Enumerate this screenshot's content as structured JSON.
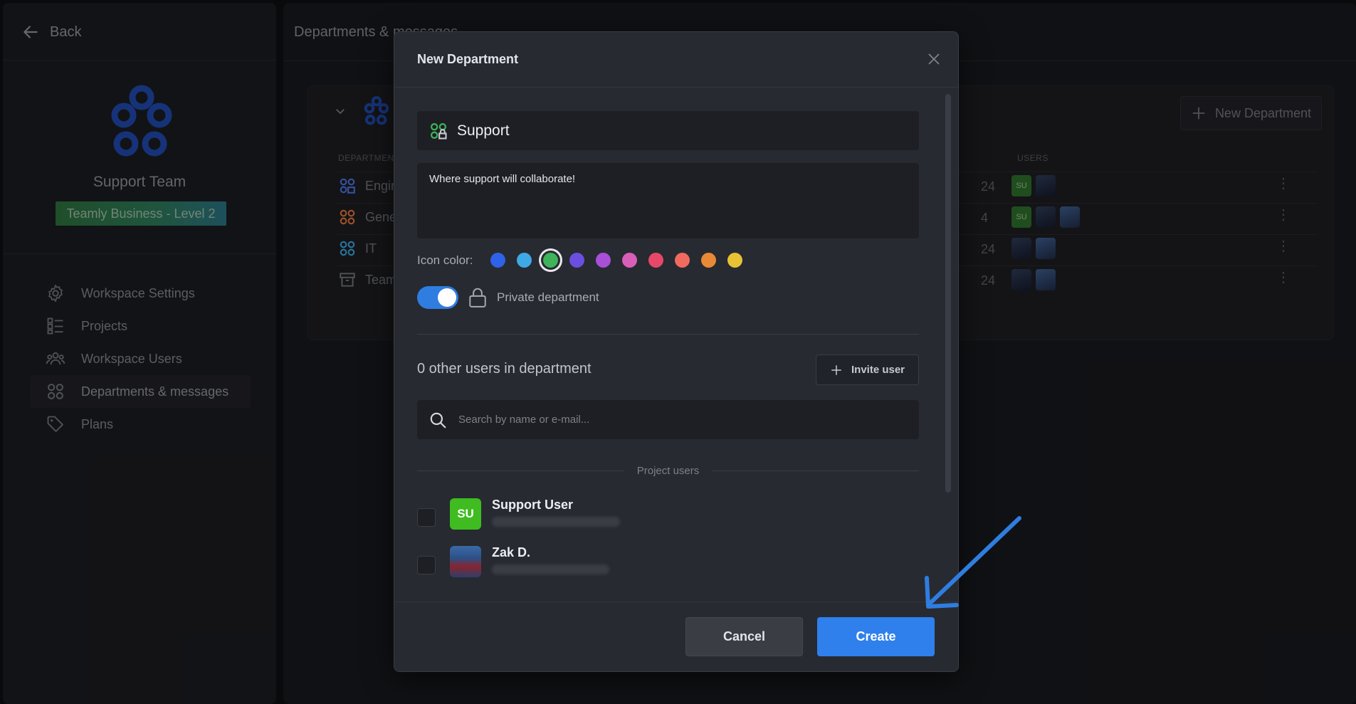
{
  "sidebar": {
    "back_label": "Back",
    "team_name": "Support Team",
    "plan_badge": "Teamly Business - Level 2",
    "nav": [
      {
        "label": "Workspace Settings",
        "icon": "gear-icon"
      },
      {
        "label": "Projects",
        "icon": "projects-icon"
      },
      {
        "label": "Workspace Users",
        "icon": "users-icon"
      },
      {
        "label": "Departments & messages",
        "icon": "departments-icon",
        "active": true
      },
      {
        "label": "Plans",
        "icon": "tag-icon"
      }
    ]
  },
  "main": {
    "title": "Departments & messages",
    "new_department_label": "New Department",
    "columns": {
      "department": "DEPARTMENT",
      "users": "USERS"
    },
    "rows": [
      {
        "name": "Engin",
        "date_fragment": "24",
        "color": "#4a6fd8"
      },
      {
        "name": "Gene",
        "date_fragment": "4",
        "color": "#d8713a"
      },
      {
        "name": "IT",
        "date_fragment": "24",
        "color": "#3aa0d8"
      },
      {
        "name": "Team",
        "date_fragment": "24",
        "color": "#6f7278"
      }
    ]
  },
  "modal": {
    "title": "New Department",
    "name_value": "Support",
    "description_value": "Where support will collaborate!",
    "icon_color_label": "Icon color:",
    "colors": [
      "#2e62e8",
      "#3fa9e6",
      "#3fb35a",
      "#6b4fe0",
      "#a84fd8",
      "#d85fb8",
      "#e84868",
      "#f06a60",
      "#e88a35",
      "#e8c235"
    ],
    "selected_color_index": 2,
    "private_enabled": true,
    "private_label": "Private department",
    "users_count_label": "0 other users in department",
    "invite_label": "Invite user",
    "search_placeholder": "Search by name or e-mail...",
    "section_label": "Project users",
    "users": [
      {
        "name": "Support User",
        "initials": "SU"
      },
      {
        "name": "Zak D.",
        "initials": ""
      }
    ],
    "cancel_label": "Cancel",
    "create_label": "Create"
  },
  "colors": {
    "accent": "#2f80ed",
    "modal_bg": "#272a31",
    "page_bg": "#0d0e11"
  }
}
